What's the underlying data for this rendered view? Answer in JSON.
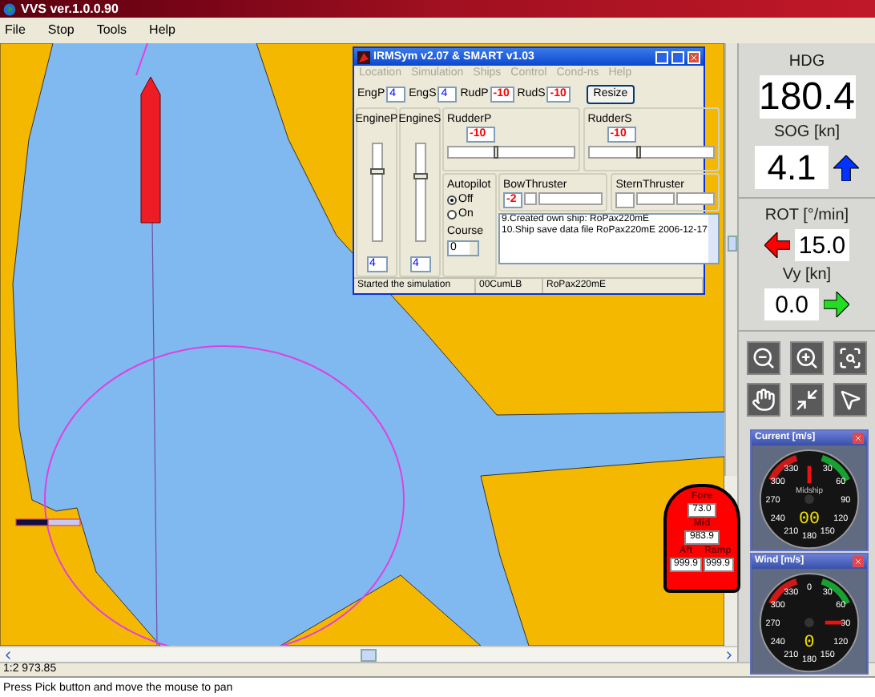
{
  "window": {
    "title": "VVS ver.1.0.0.90"
  },
  "menu": [
    "File",
    "Stop",
    "Tools",
    "Help"
  ],
  "sim_window": {
    "title": "IRMSym v2.07 & SMART v1.03",
    "menu": [
      {
        "label": "Location",
        "disabled": true
      },
      {
        "label": "Simulation",
        "disabled": true
      },
      {
        "label": "Ships",
        "disabled": true
      },
      {
        "label": "Control",
        "disabled": true
      },
      {
        "label": "Cond-ns",
        "disabled": true
      },
      {
        "label": "Help",
        "disabled": true
      }
    ],
    "fields": [
      {
        "label": "EngP",
        "value": "4",
        "kind": "engine"
      },
      {
        "label": "EngS",
        "value": "4",
        "kind": "engine"
      },
      {
        "label": "RudP",
        "value": "-10",
        "kind": "rudder"
      },
      {
        "label": "RudS",
        "value": "-10",
        "kind": "rudder"
      }
    ],
    "resize_button": "Resize",
    "engines": [
      {
        "label": "EngineP",
        "value": "4",
        "level": 0.72
      },
      {
        "label": "EngineS",
        "value": "4",
        "level": 0.67
      }
    ],
    "rudders": [
      {
        "label": "RudderP",
        "value": "-10",
        "level": 0.37
      },
      {
        "label": "RudderS",
        "value": "-10",
        "level": 0.39
      }
    ],
    "autopilot": {
      "label": "Autopilot",
      "options": [
        {
          "label": "Off",
          "selected": true
        },
        {
          "label": "On",
          "selected": false
        }
      ],
      "course_label": "Course",
      "course_value": "0"
    },
    "bow_thruster": {
      "label": "BowThruster",
      "value": "-2"
    },
    "stern_thruster": {
      "label": "SternThruster"
    },
    "log": [
      "9.Created own ship: RoPax220mE",
      "10.Ship save data file RoPax220mE  2006-12-17"
    ],
    "status": [
      "Started the simulation",
      "00CumLB",
      "RoPax220mE"
    ]
  },
  "instruments": [
    {
      "label": "HDG",
      "value": "180.4",
      "kind": "plain"
    },
    {
      "label": "SOG [kn]",
      "value": "4.1",
      "kind": "up",
      "color": "#0033ff"
    },
    {
      "label": "ROT [°/min]",
      "value": "15.0",
      "kind": "left",
      "color": "#ff0000"
    },
    {
      "label": "Vy [kn]",
      "value": "0.0",
      "kind": "right",
      "color": "#22dd22"
    }
  ],
  "tools": [
    {
      "kind": "zoom-out"
    },
    {
      "kind": "zoom-in"
    },
    {
      "kind": "zoom-window"
    },
    {
      "kind": "pan"
    },
    {
      "kind": "fit"
    },
    {
      "kind": "pointer"
    }
  ],
  "draft": [
    {
      "label": "Fore",
      "value": "73.0"
    },
    {
      "label": "Mid",
      "value": "983.9"
    },
    {
      "label": "Aft",
      "value": "999.9"
    },
    {
      "label": "Ramp",
      "value": "999.9"
    }
  ],
  "gauges": [
    {
      "title": "Current [m/s]",
      "center_label": "Midship",
      "dial_labels": [
        "330",
        "30",
        "300",
        "60",
        "270",
        "90",
        "240",
        "120",
        "210",
        "150",
        "180"
      ],
      "readout": "00"
    },
    {
      "title": "Wind [m/s]",
      "dial_labels": [
        "0",
        "330",
        "30",
        "300",
        "60",
        "270",
        "90",
        "240",
        "120",
        "210",
        "150",
        "180"
      ],
      "readout": "0"
    }
  ],
  "scale": "1:2 973.85",
  "status": "Press Pick button and move the mouse to pan"
}
